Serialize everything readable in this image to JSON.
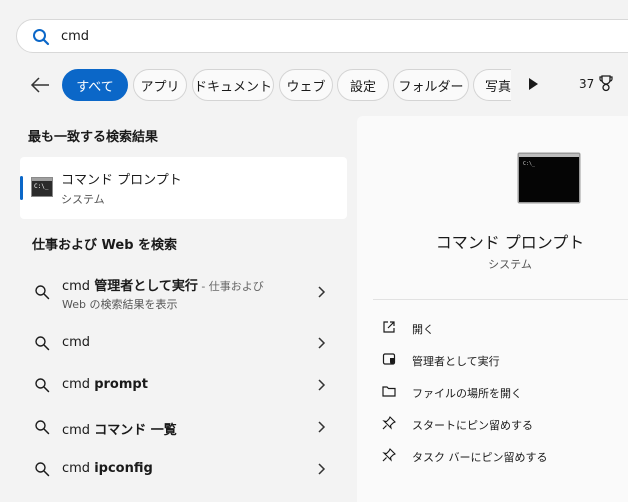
{
  "search": {
    "query": "cmd"
  },
  "filters": {
    "chips": [
      "すべて",
      "アプリ",
      "ドキュメント",
      "ウェブ",
      "設定",
      "フォルダー",
      "写真"
    ],
    "count": "37"
  },
  "best_match": {
    "heading": "最も一致する検索結果",
    "app_name": "コマンド プロンプト",
    "app_type": "システム"
  },
  "web": {
    "heading": "仕事および Web を検索",
    "rows": [
      {
        "prefix": "cmd ",
        "bold": "管理者として実行",
        "suffix": " - 仕事および",
        "sub": "Web の検索結果を表示"
      },
      {
        "prefix": "cmd",
        "bold": "",
        "suffix": "",
        "sub": ""
      },
      {
        "prefix": "cmd ",
        "bold": "prompt",
        "suffix": "",
        "sub": ""
      },
      {
        "prefix": "cmd ",
        "bold": "コマンド 一覧",
        "suffix": "",
        "sub": ""
      },
      {
        "prefix": "cmd ",
        "bold": "ipconfig",
        "suffix": "",
        "sub": ""
      }
    ]
  },
  "detail": {
    "title": "コマンド プロンプト",
    "subtitle": "システム",
    "actions": [
      {
        "label": "開く",
        "icon": "open-icon"
      },
      {
        "label": "管理者として実行",
        "icon": "shield-icon"
      },
      {
        "label": "ファイルの場所を開く",
        "icon": "folder-icon"
      },
      {
        "label": "スタートにピン留めする",
        "icon": "pin-icon"
      },
      {
        "label": "タスク バーにピン留めする",
        "icon": "pin-icon"
      }
    ]
  },
  "colors": {
    "accent": "#0b67c8",
    "background": "#f3f3f3"
  }
}
